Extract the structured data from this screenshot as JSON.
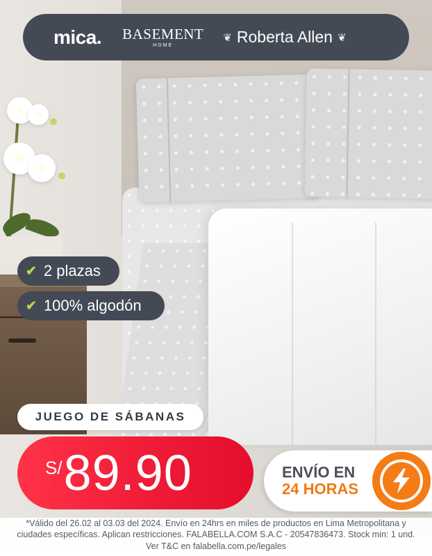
{
  "brands": {
    "mica": "mica.",
    "basement_main": "BASEMENT",
    "basement_sub": "HOME",
    "roberta": "Roberta Allen"
  },
  "features": [
    {
      "icon": "check-icon",
      "label": "2 plazas"
    },
    {
      "icon": "check-icon",
      "label": "100% algodón"
    }
  ],
  "product": {
    "label": "JUEGO DE SÁBANAS"
  },
  "price": {
    "currency": "S/",
    "amount": "89.90",
    "color": "#f01c37"
  },
  "shipping": {
    "line1": "ENVÍO EN",
    "line2": "24 HORAS",
    "icon": "lightning-bolt-icon",
    "accent_color": "#f47b16"
  },
  "legal": {
    "line1": "*Válido del 26.02 al 03.03 del 2024. Envío en 24hrs en miles de productos en Lima Metropolitana y",
    "line2": "ciudades específicas. Aplican restricciones. FALABELLA.COM S.A.C - 20547836473. Stock min: 1 und.",
    "line3": "Ver T&C en falabella.com.pe/legales"
  },
  "colors": {
    "pill_dark": "#434a55",
    "check_green": "#b9d54a"
  }
}
